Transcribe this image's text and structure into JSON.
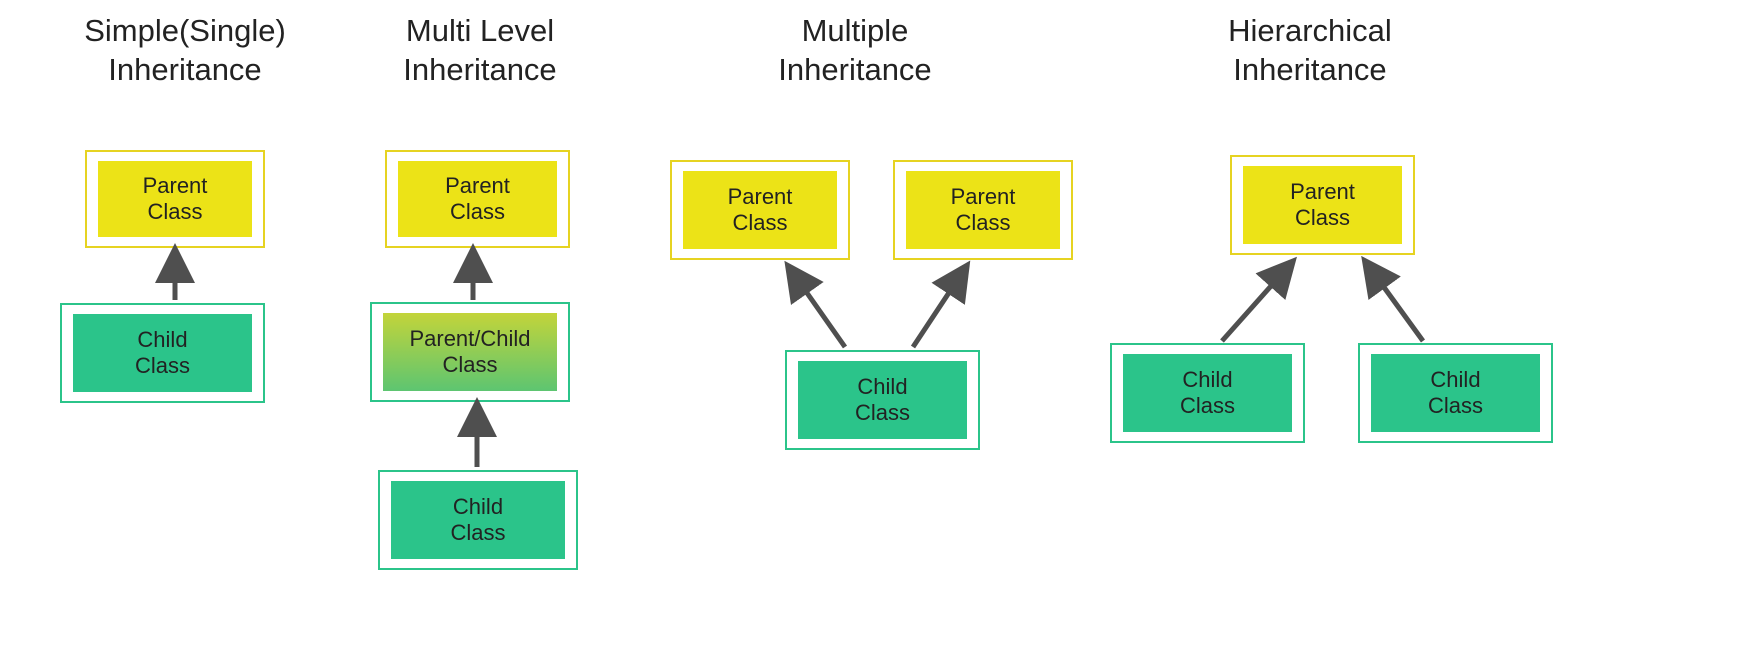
{
  "colors": {
    "parent_fill": "#ece317",
    "parent_border": "#e6d321",
    "child_fill": "#2bc48a",
    "child_border": "#2bc48a",
    "arrow": "#4f4f4f",
    "gradient_top": "#c3d43a",
    "gradient_bottom": "#5dc571"
  },
  "diagrams": {
    "single": {
      "title": "Simple(Single)\nInheritance",
      "parent": "Parent\nClass",
      "child": "Child\nClass"
    },
    "multilevel": {
      "title": "Multi Level\nInheritance",
      "parent": "Parent\nClass",
      "middle": "Parent/Child\nClass",
      "child": "Child\nClass"
    },
    "multiple": {
      "title": "Multiple\nInheritance",
      "parent1": "Parent\nClass",
      "parent2": "Parent\nClass",
      "child": "Child\nClass"
    },
    "hierarchical": {
      "title": "Hierarchical\nInheritance",
      "parent": "Parent\nClass",
      "child1": "Child\nClass",
      "child2": "Child\nClass"
    }
  }
}
